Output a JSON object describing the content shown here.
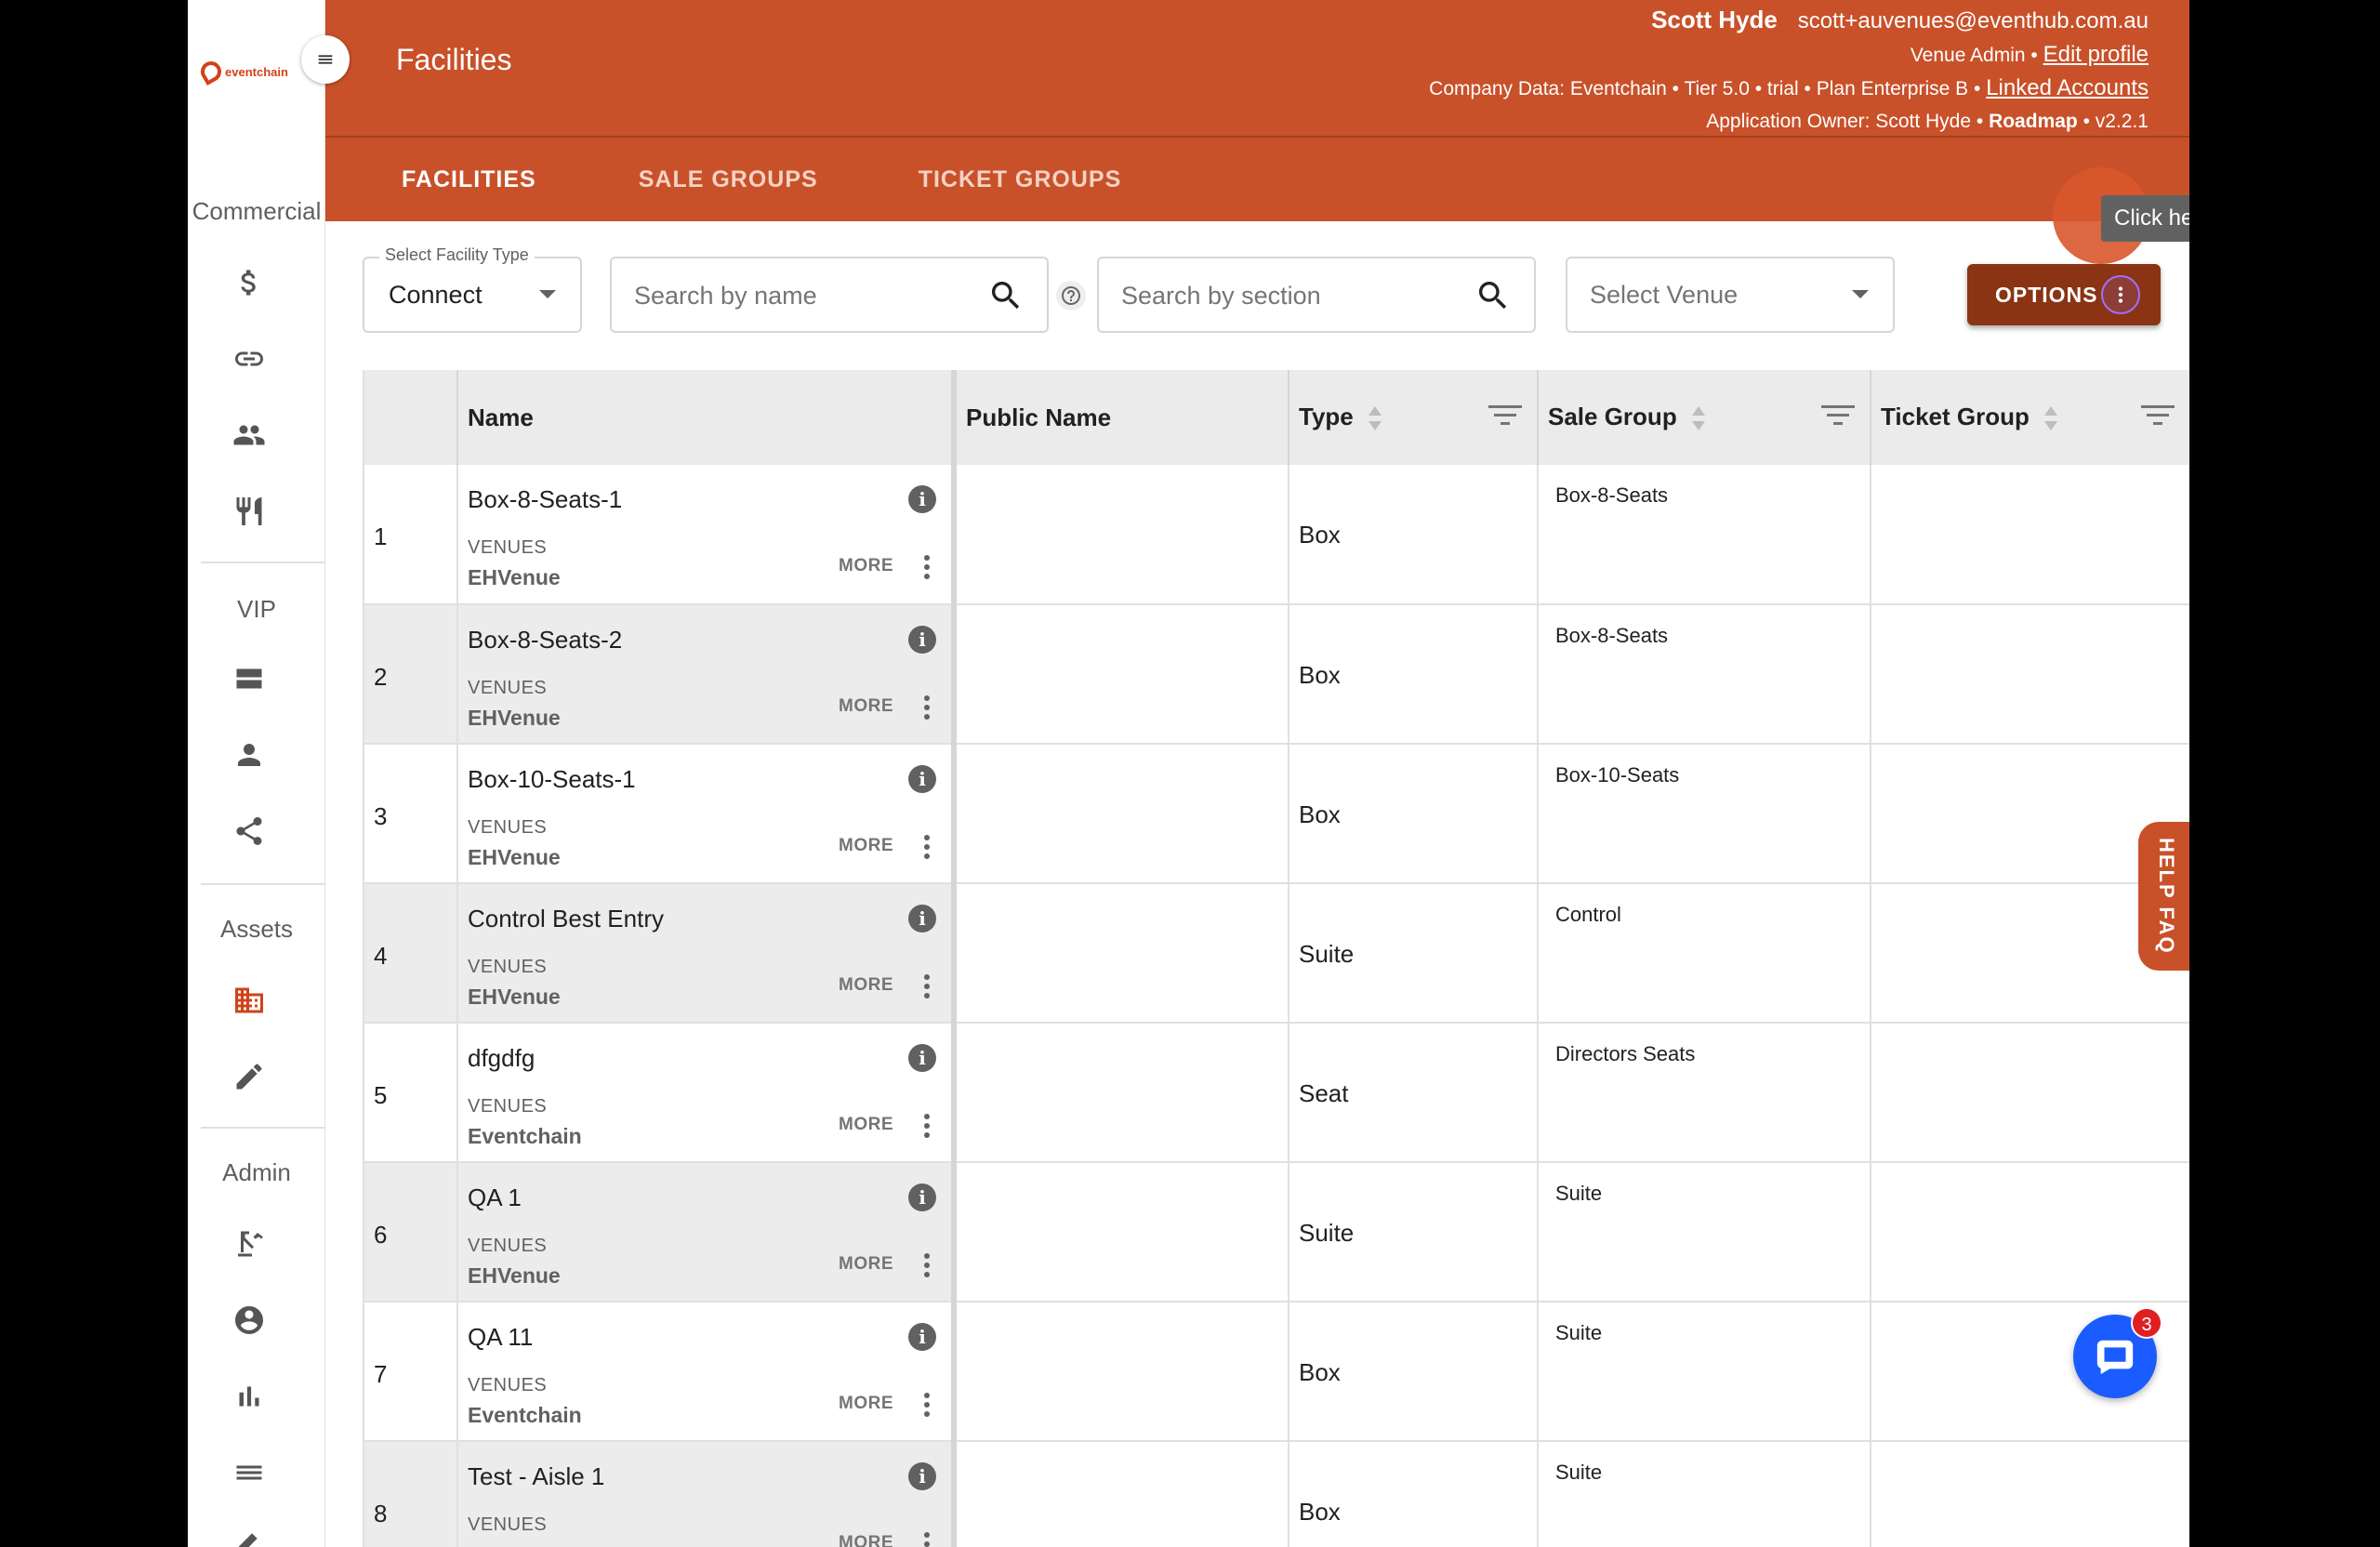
{
  "app": {
    "logo_text": "eventchain",
    "page_title": "Facilities"
  },
  "header": {
    "user_name": "Scott Hyde",
    "user_email": "scott+auvenues@eventhub.com.au",
    "role": "Venue Admin •",
    "edit_profile": "Edit profile",
    "company_line": "Company Data: Eventchain • Tier 5.0 • trial • Plan Enterprise B •",
    "linked_accounts": "Linked Accounts",
    "owner_line": "Application Owner: Scott Hyde •",
    "roadmap": "Roadmap",
    "version": "• v2.2.1"
  },
  "tabs": [
    {
      "label": "FACILITIES",
      "active": true
    },
    {
      "label": "SALE GROUPS",
      "active": false
    },
    {
      "label": "TICKET GROUPS",
      "active": false
    }
  ],
  "sidebar": {
    "sections": [
      {
        "label": "Commercial",
        "icons": [
          "dollar-icon",
          "link-icon",
          "people-icon",
          "restaurant-icon"
        ]
      },
      {
        "label": "VIP",
        "icons": [
          "box-icon",
          "person-icon",
          "share-icon"
        ]
      },
      {
        "label": "Assets",
        "icons": [
          "building-icon",
          "pencil-icon"
        ]
      },
      {
        "label": "Admin",
        "icons": [
          "crane-icon",
          "account-circle-icon",
          "bar-chart-icon",
          "list-icon",
          "edit-icon"
        ]
      }
    ]
  },
  "filters": {
    "facility_type_label": "Select Facility Type",
    "facility_type_value": "Connect",
    "search_name_placeholder": "Search by name",
    "search_section_placeholder": "Search by section",
    "venue_placeholder": "Select Venue",
    "options_label": "OPTIONS",
    "tooltip": "Click here for more Actions"
  },
  "table": {
    "columns": [
      "",
      "Name",
      "Public Name",
      "Type",
      "Sale Group",
      "Ticket Group"
    ],
    "venues_label": "VENUES",
    "more_label": "MORE",
    "rows": [
      {
        "num": "1",
        "name": "Box-8-Seats-1",
        "venue": "EHVenue",
        "public_name": "",
        "type": "Box",
        "sale_group": "Box-8-Seats",
        "ticket_group": ""
      },
      {
        "num": "2",
        "name": "Box-8-Seats-2",
        "venue": "EHVenue",
        "public_name": "",
        "type": "Box",
        "sale_group": "Box-8-Seats",
        "ticket_group": ""
      },
      {
        "num": "3",
        "name": "Box-10-Seats-1",
        "venue": "EHVenue",
        "public_name": "",
        "type": "Box",
        "sale_group": "Box-10-Seats",
        "ticket_group": ""
      },
      {
        "num": "4",
        "name": "Control Best Entry",
        "venue": "EHVenue",
        "public_name": "",
        "type": "Suite",
        "sale_group": "Control",
        "ticket_group": ""
      },
      {
        "num": "5",
        "name": "dfgdfg",
        "venue": "Eventchain",
        "public_name": "",
        "type": "Seat",
        "sale_group": "Directors Seats",
        "ticket_group": ""
      },
      {
        "num": "6",
        "name": "QA 1",
        "venue": "EHVenue",
        "public_name": "",
        "type": "Suite",
        "sale_group": "Suite",
        "ticket_group": ""
      },
      {
        "num": "7",
        "name": "QA 11",
        "venue": "Eventchain",
        "public_name": "",
        "type": "Box",
        "sale_group": "Suite",
        "ticket_group": ""
      },
      {
        "num": "8",
        "name": "Test - Aisle 1",
        "venue": "",
        "public_name": "",
        "type": "Box",
        "sale_group": "Suite",
        "ticket_group": ""
      }
    ]
  },
  "widgets": {
    "help_faq": "HELP FAQ",
    "chat_badge": "3"
  }
}
